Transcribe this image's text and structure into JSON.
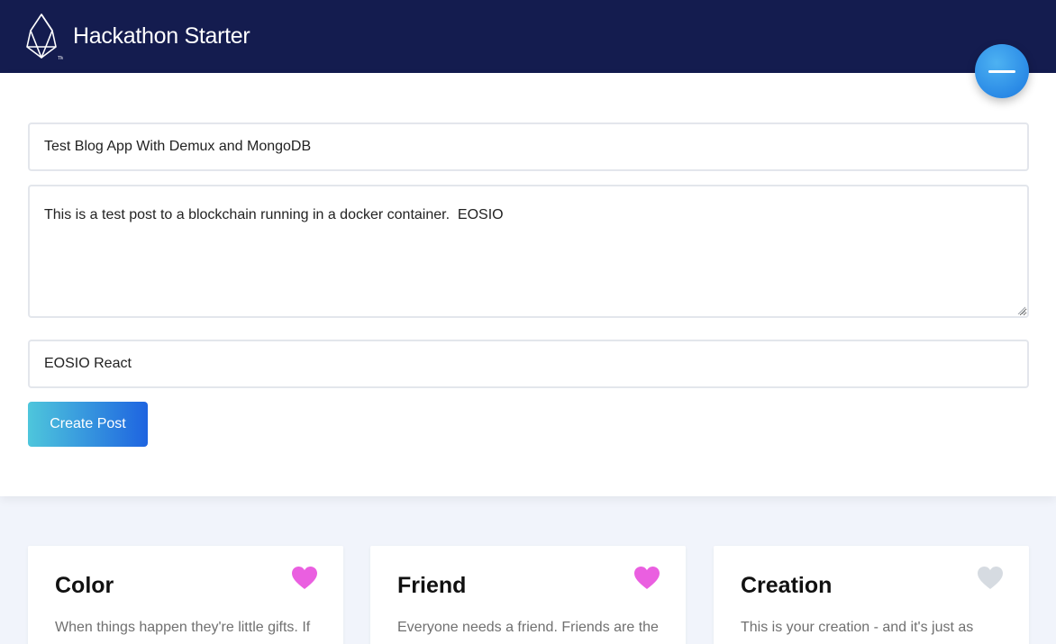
{
  "header": {
    "app_title": "Hackathon Starter",
    "logo_icon": "eos-logo-icon",
    "background": "#141c4f"
  },
  "form": {
    "title_value": "Test Blog App With Demux and MongoDB",
    "body_value": "This is a test post to a blockchain running in a docker container.  EOSIO",
    "tags_value": "EOSIO React",
    "create_label": "Create Post"
  },
  "fab": {
    "icon": "minus-icon"
  },
  "cards": [
    {
      "title": "Color",
      "text": "When things happen they're little gifts. If",
      "liked": true,
      "heart_color": "#ea5fe0"
    },
    {
      "title": "Friend",
      "text": "Everyone needs a friend. Friends are the",
      "liked": true,
      "heart_color": "#ea5fe0"
    },
    {
      "title": "Creation",
      "text": "This is your creation - and it's just as",
      "liked": false,
      "heart_color": "#d6dbe1"
    }
  ],
  "colors": {
    "accent_gradient_start": "#4ec6dc",
    "accent_gradient_end": "#1e64e0",
    "page_background": "#f1f4fb"
  }
}
